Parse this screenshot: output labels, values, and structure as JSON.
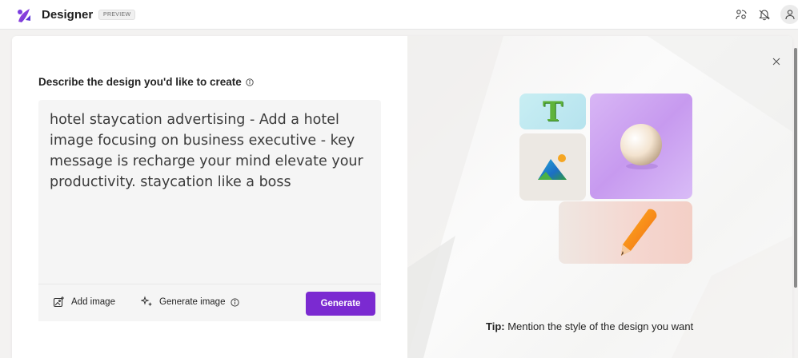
{
  "app": {
    "title": "Designer",
    "badge": "PREVIEW"
  },
  "topbar_icons": [
    "share-icon",
    "notifications-icon",
    "profile-icon"
  ],
  "dialog": {
    "heading": "Describe the design you'd like to create",
    "prompt_value": "hotel staycation advertising - Add a hotel image focusing on business executive - key message is recharge your mind elevate your productivity. staycation like a boss",
    "actions": {
      "add_image": "Add image",
      "generate_image": "Generate image",
      "generate": "Generate"
    },
    "tip_label": "Tip:",
    "tip_text": " Mention the style of the design you want",
    "tile_letter": "T"
  },
  "colors": {
    "accent": "#7b2ad1",
    "tile_text": "#c8eef3",
    "tile_sphere": "#d0a8f3",
    "tile_pencil": "#f5d6cf"
  }
}
